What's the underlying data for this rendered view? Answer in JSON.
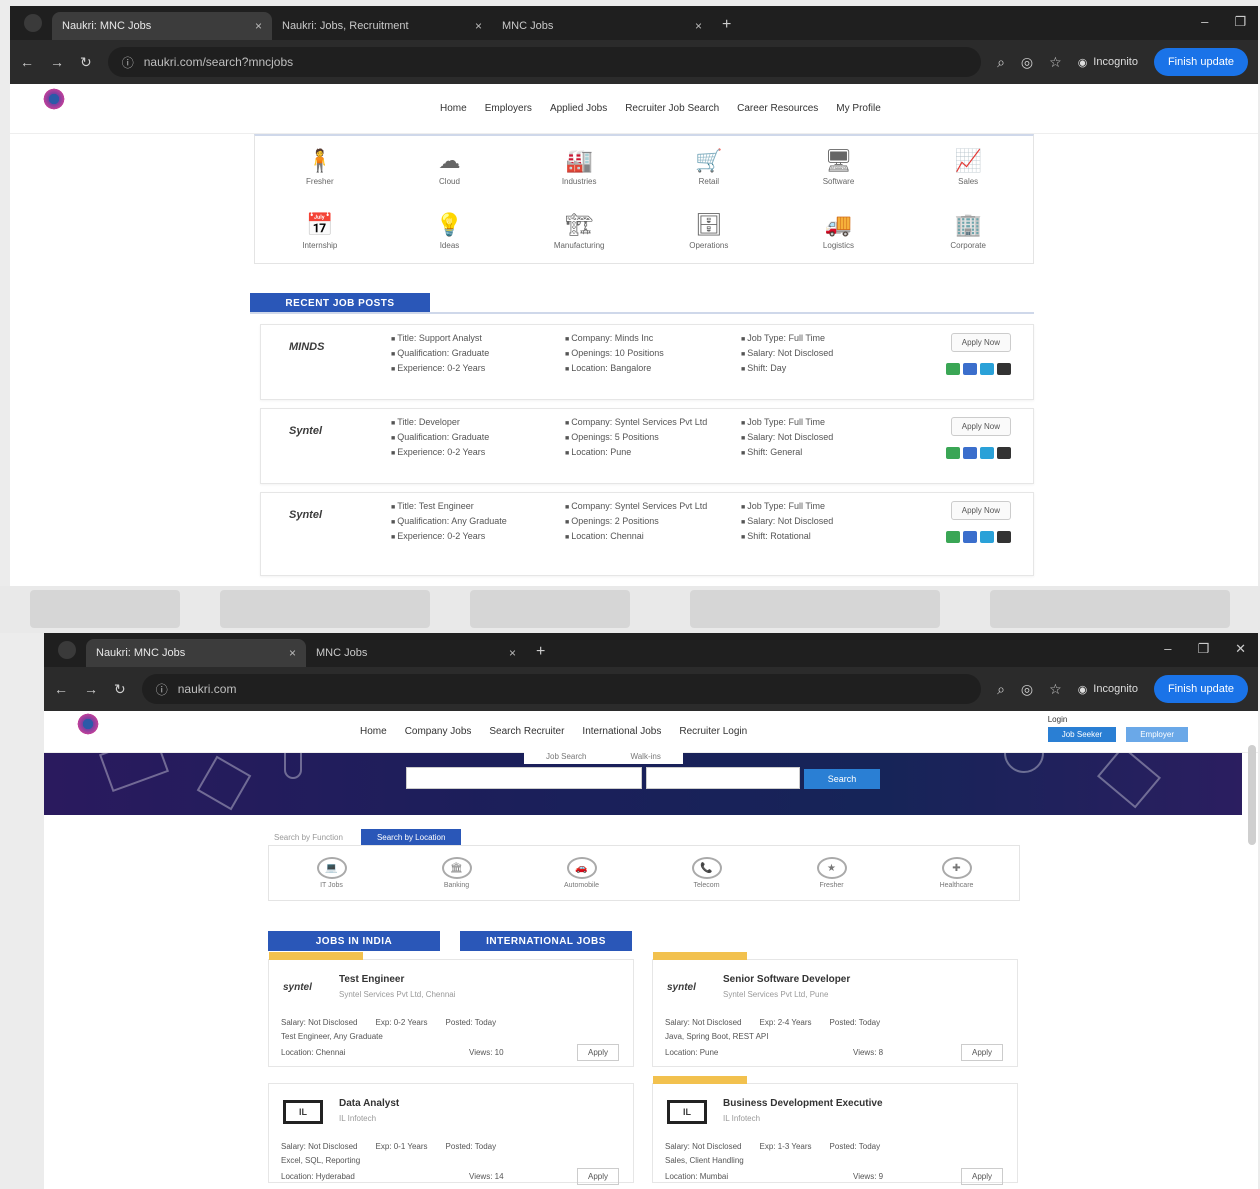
{
  "shot1": {
    "tabs": [
      {
        "label": "Naukri: MNC Jobs",
        "close": "×"
      },
      {
        "label": "Naukri: Jobs, Recruitment",
        "close": "×"
      },
      {
        "label": "MNC Jobs",
        "close": "×"
      }
    ],
    "new_tab": "+",
    "url": "naukri.com/search?mncjobs",
    "incognito": "Incognito",
    "update_btn": "Finish update",
    "nav": [
      "Home",
      "Employers",
      "Applied Jobs",
      "Recruiter Job Search",
      "Career Resources",
      "My Profile"
    ],
    "categories": [
      {
        "icon": "person-icon",
        "glyph": "🧍",
        "label": "Fresher"
      },
      {
        "icon": "cloud-icon",
        "glyph": "☁",
        "label": "Cloud"
      },
      {
        "icon": "factory-icon",
        "glyph": "🏭",
        "label": "Industries"
      },
      {
        "icon": "cart-icon",
        "glyph": "🛒",
        "label": "Retail"
      },
      {
        "icon": "device-icon",
        "glyph": "🖥",
        "label": "Software"
      },
      {
        "icon": "chart-icon",
        "glyph": "📈",
        "label": "Sales"
      },
      {
        "icon": "calendar-icon",
        "glyph": "📅",
        "label": "Internship"
      },
      {
        "icon": "bulb-icon",
        "glyph": "💡",
        "label": "Ideas"
      },
      {
        "icon": "plant-icon",
        "glyph": "🏗",
        "label": "Manufacturing"
      },
      {
        "icon": "desk-icon",
        "glyph": "🗄",
        "label": "Operations"
      },
      {
        "icon": "truck-icon",
        "glyph": "🚚",
        "label": "Logistics"
      },
      {
        "icon": "building-icon",
        "glyph": "🏢",
        "label": "Corporate"
      }
    ],
    "section_title": "RECENT JOB POSTS",
    "jobs": [
      {
        "company": "MINDS",
        "c1": [
          "Title: Support Analyst",
          "Qualification: Graduate",
          "Experience: 0-2 Years"
        ],
        "c2": [
          "Company: Minds Inc",
          "Openings: 10 Positions",
          "Location: Bangalore"
        ],
        "c3": [
          "Job Type: Full Time",
          "Salary: Not Disclosed",
          "Shift: Day"
        ],
        "apply": "Apply Now"
      },
      {
        "company": "Syntel",
        "c1": [
          "Title: Developer",
          "Qualification: Graduate",
          "Experience: 0-2 Years"
        ],
        "c2": [
          "Company: Syntel Services Pvt Ltd",
          "Openings: 5 Positions",
          "Location: Pune"
        ],
        "c3": [
          "Job Type: Full Time",
          "Salary: Not Disclosed",
          "Shift: General"
        ],
        "apply": "Apply Now"
      },
      {
        "company": "Syntel",
        "c1": [
          "Title: Test Engineer",
          "Qualification: Any Graduate",
          "Experience: 0-2 Years"
        ],
        "c2": [
          "Company: Syntel Services Pvt Ltd",
          "Openings: 2 Positions",
          "Location: Chennai"
        ],
        "c3": [
          "Job Type: Full Time",
          "Salary: Not Disclosed",
          "Shift: Rotational"
        ],
        "apply": "Apply Now"
      }
    ],
    "share_colors": [
      "#3aa655",
      "#3b6ecc",
      "#2aa1d8",
      "#333333"
    ]
  },
  "shot2": {
    "tabs": [
      {
        "label": "Naukri: MNC Jobs",
        "close": "×"
      },
      {
        "label": "MNC Jobs",
        "close": "×"
      }
    ],
    "new_tab": "+",
    "url": "naukri.com",
    "incognito": "Incognito",
    "update_btn": "Finish update",
    "nav": [
      "Home",
      "Company Jobs",
      "Search Recruiter",
      "International Jobs",
      "Recruiter Login"
    ],
    "login_label": "Login",
    "login_btn": "Job Seeker",
    "register_btn": "Employer",
    "search_tabs": [
      "Job Search",
      "Walk-ins"
    ],
    "search_button": "Search",
    "filter_tabs": [
      "Search by Function",
      "Search by Location"
    ],
    "filters": [
      {
        "icon": "it-icon",
        "glyph": "💻",
        "label": "IT Jobs"
      },
      {
        "icon": "bank-icon",
        "glyph": "🏛",
        "label": "Banking"
      },
      {
        "icon": "car-icon",
        "glyph": "🚗",
        "label": "Automobile"
      },
      {
        "icon": "phone-icon",
        "glyph": "📞",
        "label": "Telecom"
      },
      {
        "icon": "star-icon",
        "glyph": "★",
        "label": "Fresher"
      },
      {
        "icon": "health-icon",
        "glyph": "✚",
        "label": "Healthcare"
      }
    ],
    "job_tabs": [
      "JOBS IN INDIA",
      "INTERNATIONAL JOBS"
    ],
    "cards": [
      {
        "logo": "syntel",
        "title": "Test Engineer",
        "sub": "Syntel Services Pvt Ltd, Chennai",
        "meta": [
          "Salary: Not Disclosed",
          "Exp: 0-2 Years",
          "Posted: Today"
        ],
        "l2": "Test Engineer, Any Graduate",
        "l3": "Location: Chennai",
        "views": "Views: 10",
        "apply": "Apply"
      },
      {
        "logo": "syntel",
        "title": "Senior Software Developer",
        "sub": "Syntel Services Pvt Ltd, Pune",
        "meta": [
          "Salary: Not Disclosed",
          "Exp: 2-4 Years",
          "Posted: Today"
        ],
        "l2": "Java, Spring Boot, REST API",
        "l3": "Location: Pune",
        "views": "Views: 8",
        "apply": "Apply"
      },
      {
        "logo": "IL",
        "title": "Data Analyst",
        "sub": "IL Infotech",
        "meta": [
          "Salary: Not Disclosed",
          "Exp: 0-1 Years",
          "Posted: Today"
        ],
        "l2": "Excel, SQL, Reporting",
        "l3": "Location: Hyderabad",
        "views": "Views: 14",
        "apply": "Apply"
      },
      {
        "logo": "IL",
        "title": "Business Development Executive",
        "sub": "IL Infotech",
        "meta": [
          "Salary: Not Disclosed",
          "Exp: 1-3 Years",
          "Posted: Today"
        ],
        "l2": "Sales, Client Handling",
        "l3": "Location: Mumbai",
        "views": "Views: 9",
        "apply": "Apply"
      }
    ]
  }
}
